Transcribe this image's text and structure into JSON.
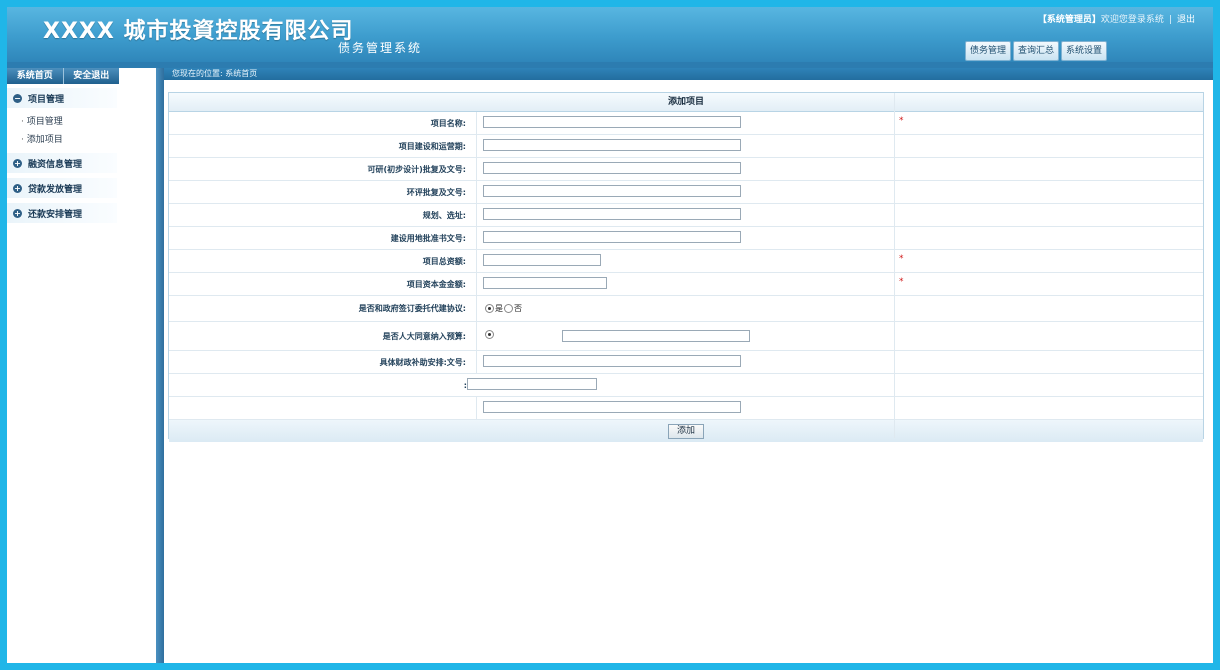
{
  "header": {
    "company": "XXXX 城市投資控股有限公司",
    "system_name": "债务管理系统",
    "role": "【系统管理员】",
    "welcome": "欢迎您登录系统",
    "logout": "退出",
    "nav": [
      "债务管理",
      "查询汇总",
      "系统设置"
    ]
  },
  "sidebar": {
    "home": "系统首页",
    "exit": "安全退出",
    "groups": [
      {
        "label": "项目管理",
        "icon": "minus-circle-icon",
        "items": [
          "项目管理",
          "添加项目"
        ]
      },
      {
        "label": "融资信息管理",
        "icon": "plus-circle-icon",
        "items": []
      },
      {
        "label": "贷款发放管理",
        "icon": "plus-circle-icon",
        "items": []
      },
      {
        "label": "还款安排管理",
        "icon": "plus-circle-icon",
        "items": []
      }
    ]
  },
  "breadcrumb": {
    "prefix": "您现在的位置:",
    "current": "系统首页"
  },
  "form": {
    "title": "添加项目",
    "fields": [
      {
        "label": "项目名称:",
        "required": true
      },
      {
        "label": "项目建设和运营期:",
        "required": false
      },
      {
        "label": "可研(初步设计)批复及文号:",
        "required": false
      },
      {
        "label": "环评批复及文号:",
        "required": false
      },
      {
        "label": "规划、选址:",
        "required": false
      },
      {
        "label": "建设用地批准书文号:",
        "required": false
      },
      {
        "label": "项目总资额:",
        "required": true
      },
      {
        "label": "项目资本金金额:",
        "required": true
      }
    ],
    "radio1": {
      "label": "是否和政府签订委托代建协议:",
      "yes": "是",
      "no": "否"
    },
    "radio2": {
      "label": "是否人大同意纳入预算:"
    },
    "finance_label": "具体财政补助安排:文号:",
    "row13_label": ":",
    "required_mark": "*",
    "submit": "添加"
  }
}
